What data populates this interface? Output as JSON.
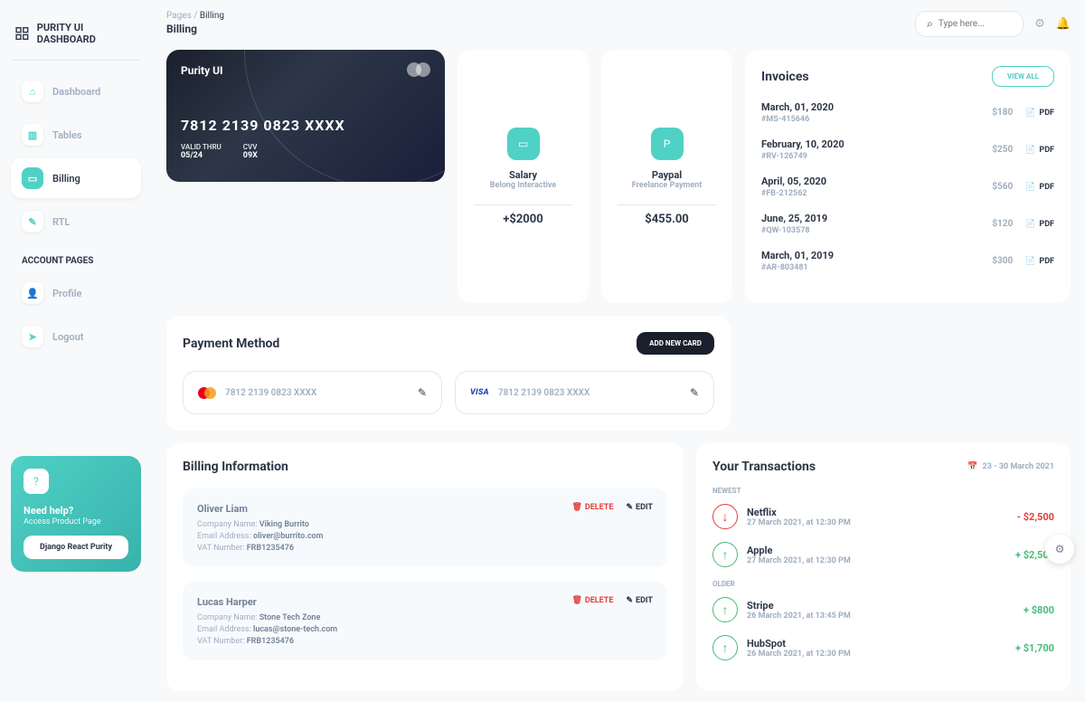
{
  "brand": "PURITY UI DASHBOARD",
  "breadcrumb": {
    "root": "Pages",
    "current": "Billing"
  },
  "page_title": "Billing",
  "search": {
    "placeholder": "Type here..."
  },
  "nav": {
    "items": [
      {
        "label": "Dashboard"
      },
      {
        "label": "Tables"
      },
      {
        "label": "Billing"
      },
      {
        "label": "RTL"
      }
    ],
    "section": "ACCOUNT PAGES",
    "account_items": [
      {
        "label": "Profile"
      },
      {
        "label": "Logout"
      }
    ]
  },
  "help": {
    "title": "Need help?",
    "subtitle": "Access Product Page",
    "button": "Django React Purity"
  },
  "credit_card": {
    "brand": "Purity UI",
    "number": "7812 2139 0823 XXXX",
    "valid_label": "VALID THRU",
    "valid": "05/24",
    "cvv_label": "CVV",
    "cvv": "09X"
  },
  "stats": [
    {
      "title": "Salary",
      "subtitle": "Belong Interactive",
      "value": "+$2000"
    },
    {
      "title": "Paypal",
      "subtitle": "Freelance Payment",
      "value": "$455.00"
    }
  ],
  "invoices": {
    "title": "Invoices",
    "view_all": "VIEW ALL",
    "pdf": "PDF",
    "items": [
      {
        "date": "March, 01, 2020",
        "id": "#MS-415646",
        "amount": "$180"
      },
      {
        "date": "February, 10, 2020",
        "id": "#RV-126749",
        "amount": "$250"
      },
      {
        "date": "April, 05, 2020",
        "id": "#FB-212562",
        "amount": "$560"
      },
      {
        "date": "June, 25, 2019",
        "id": "#QW-103578",
        "amount": "$120"
      },
      {
        "date": "March, 01, 2019",
        "id": "#AR-803481",
        "amount": "$300"
      }
    ]
  },
  "payment_method": {
    "title": "Payment Method",
    "add": "ADD NEW CARD",
    "cards": [
      {
        "type": "mc",
        "number": "7812 2139 0823 XXXX"
      },
      {
        "type": "visa",
        "label": "VISA",
        "number": "7812 2139 0823 XXXX"
      }
    ]
  },
  "billing_info": {
    "title": "Billing Information",
    "delete": "DELETE",
    "edit": "EDIT",
    "company_label": "Company Name:",
    "email_label": "Email Address:",
    "vat_label": "VAT Number:",
    "items": [
      {
        "name": "Oliver Liam",
        "company": "Viking Burrito",
        "email": "oliver@burrito.com",
        "vat": "FRB1235476"
      },
      {
        "name": "Lucas Harper",
        "company": "Stone Tech Zone",
        "email": "lucas@stone-tech.com",
        "vat": "FRB1235476"
      }
    ]
  },
  "transactions": {
    "title": "Your Transactions",
    "range": "23 - 30 March 2021",
    "newest": "NEWEST",
    "older": "OLDER",
    "items_newest": [
      {
        "name": "Netflix",
        "time": "27 March 2021, at 12:30 PM",
        "amount": "- $2,500",
        "dir": "down"
      },
      {
        "name": "Apple",
        "time": "27 March 2021, at 12:30 PM",
        "amount": "+ $2,500",
        "dir": "up"
      }
    ],
    "items_older": [
      {
        "name": "Stripe",
        "time": "26 March 2021, at 13:45 PM",
        "amount": "+ $800",
        "dir": "up"
      },
      {
        "name": "HubSpot",
        "time": "26 March 2021, at 12:30 PM",
        "amount": "+ $1,700",
        "dir": "up"
      }
    ]
  }
}
